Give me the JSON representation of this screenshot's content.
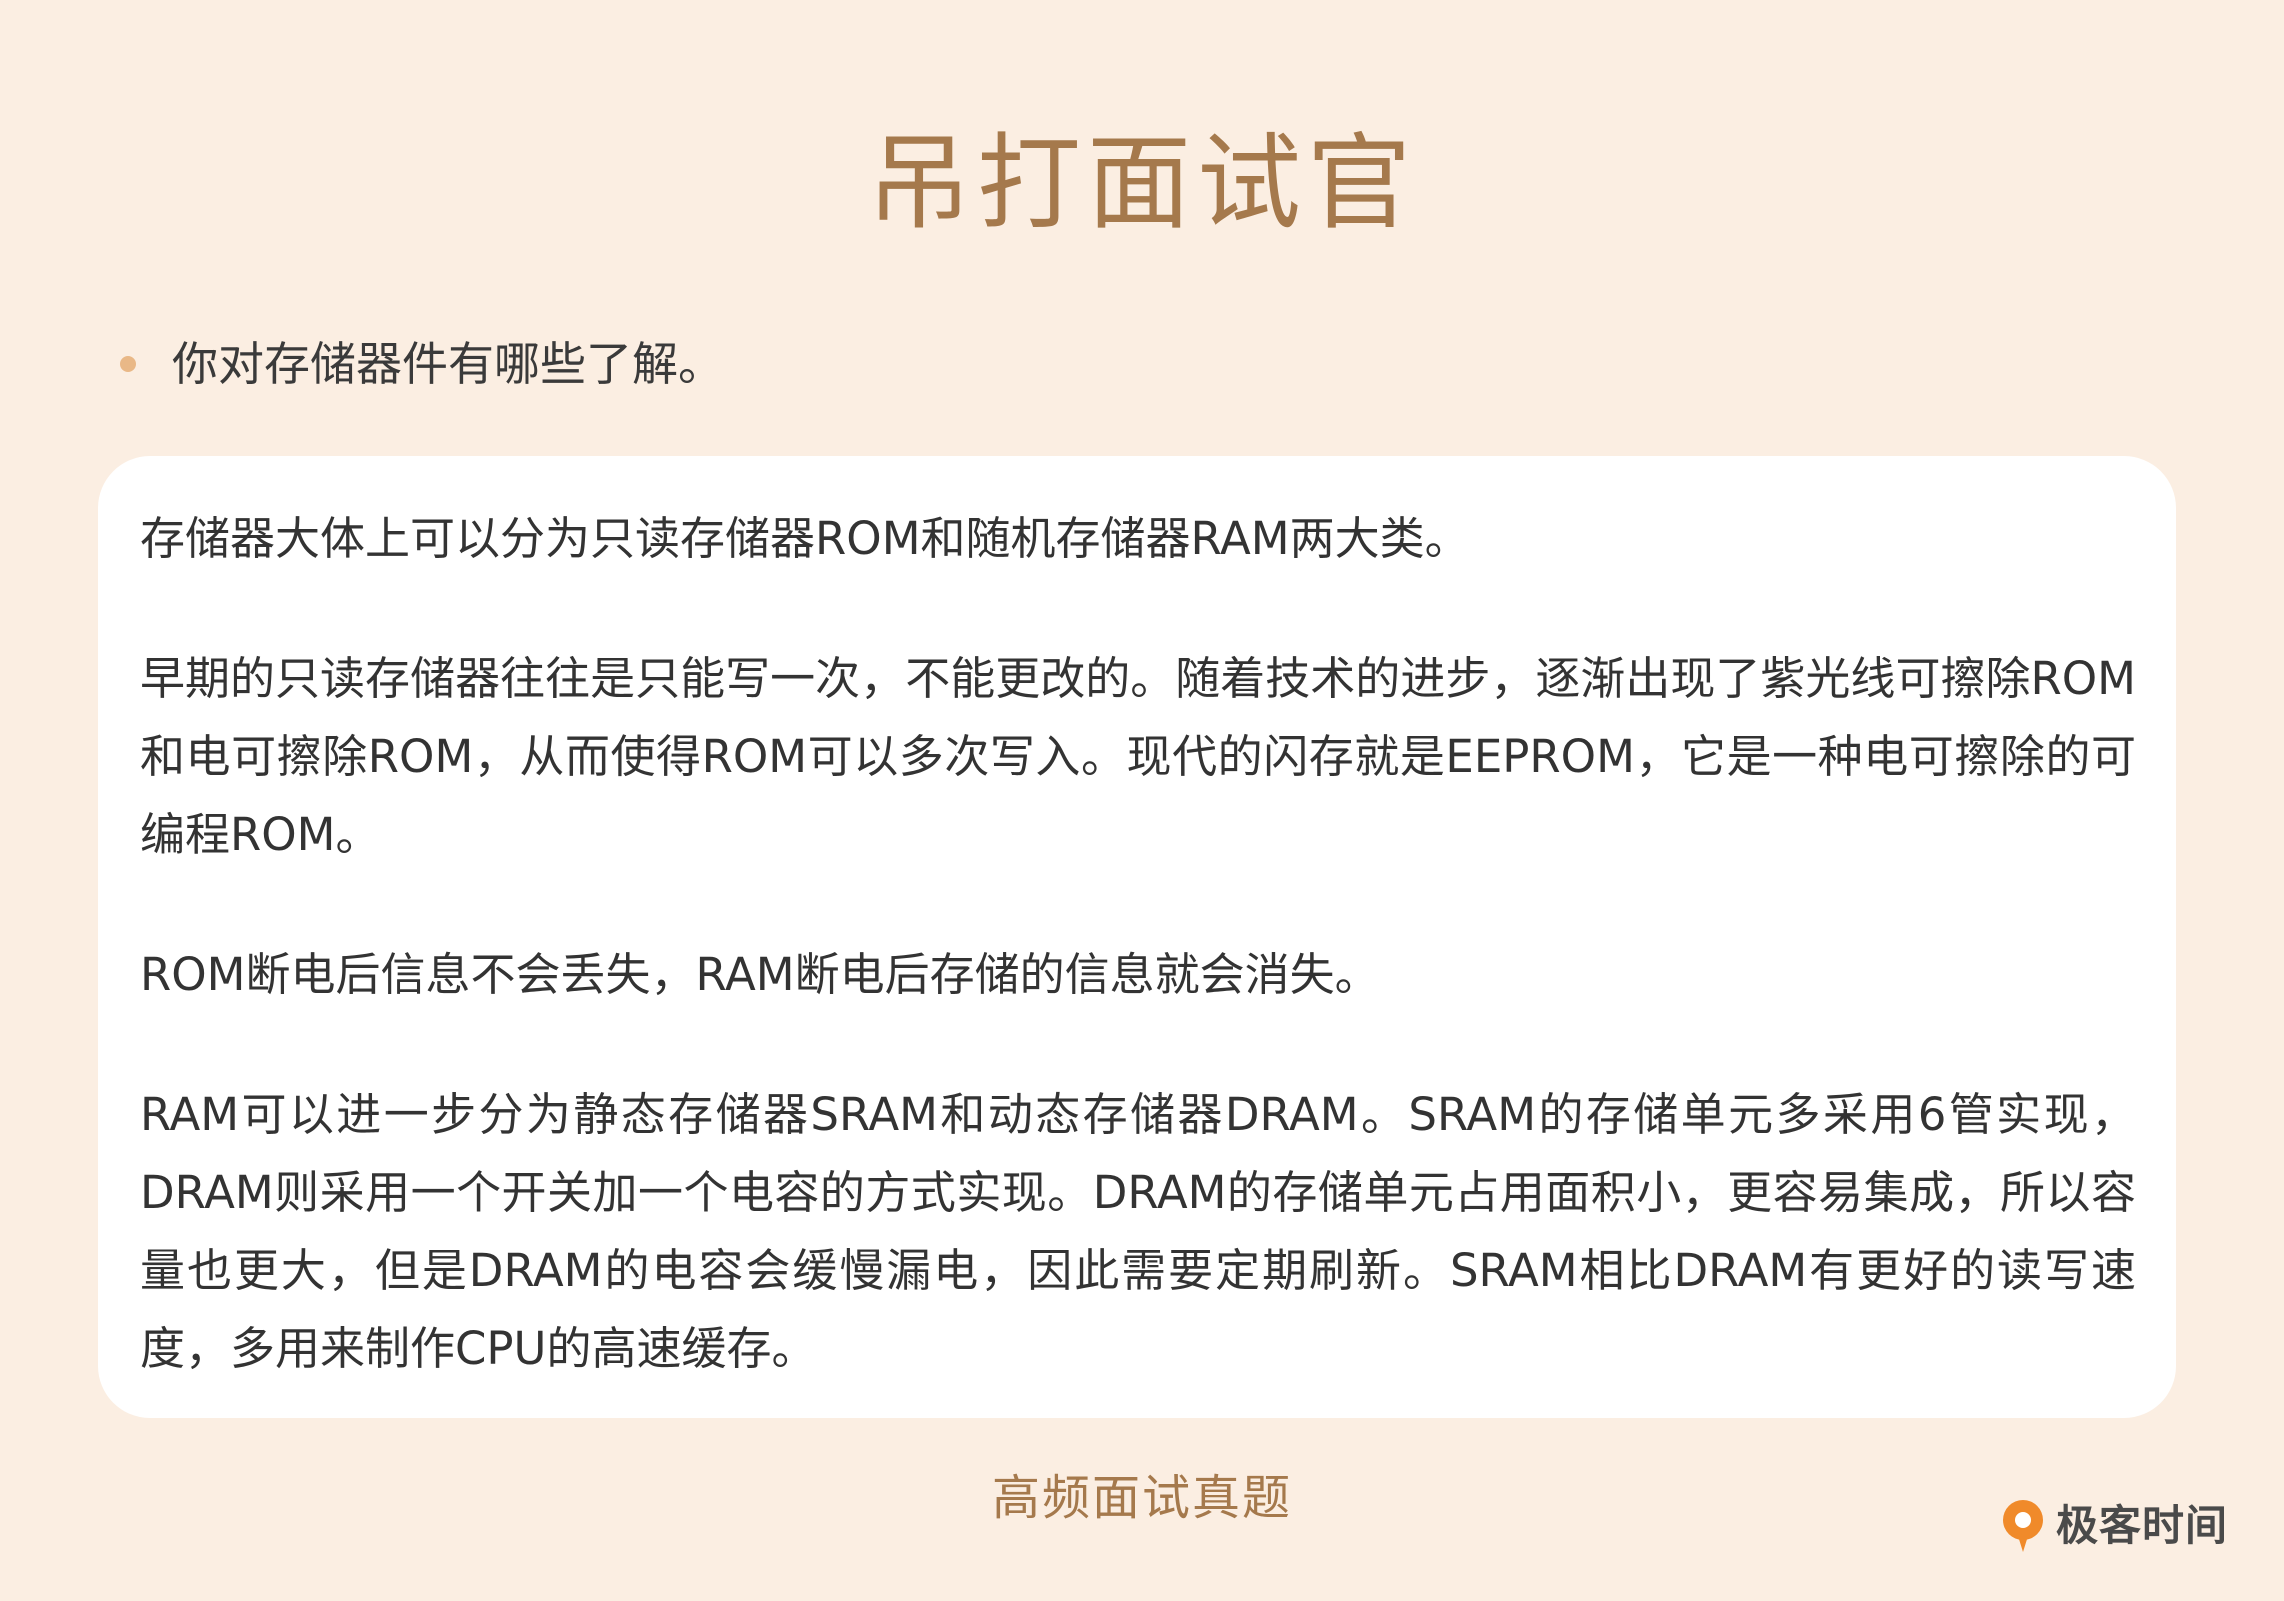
{
  "header": {
    "title": "吊打面试官"
  },
  "question": {
    "text": "你对存储器件有哪些了解。"
  },
  "answer": {
    "paragraphs": [
      "存储器大体上可以分为只读存储器ROM和随机存储器RAM两大类。",
      "早期的只读存储器往往是只能写一次，不能更改的。随着技术的进步，逐渐出现了紫光线可擦除ROM和电可擦除ROM，从而使得ROM可以多次写入。现代的闪存就是EEPROM，它是一种电可擦除的可编程ROM。",
      "ROM断电后信息不会丢失，RAM断电后存储的信息就会消失。",
      "RAM可以进一步分为静态存储器SRAM和动态存储器DRAM。SRAM的存储单元多采用6管实现，DRAM则采用一个开关加一个电容的方式实现。DRAM的存储单元占用面积小，更容易集成，所以容量也更大，但是DRAM的电容会缓慢漏电，因此需要定期刷新。SRAM相比DRAM有更好的读写速度，多用来制作CPU的高速缓存。"
    ]
  },
  "footer": {
    "label": "高频面试真题",
    "brand": "极客时间",
    "brand_icon": "geektime-logo-icon"
  },
  "colors": {
    "background": "#fbeee2",
    "accent": "#a5794c",
    "bullet": "#e9b887",
    "card": "#ffffff",
    "logo_orange": "#f08a2a"
  }
}
